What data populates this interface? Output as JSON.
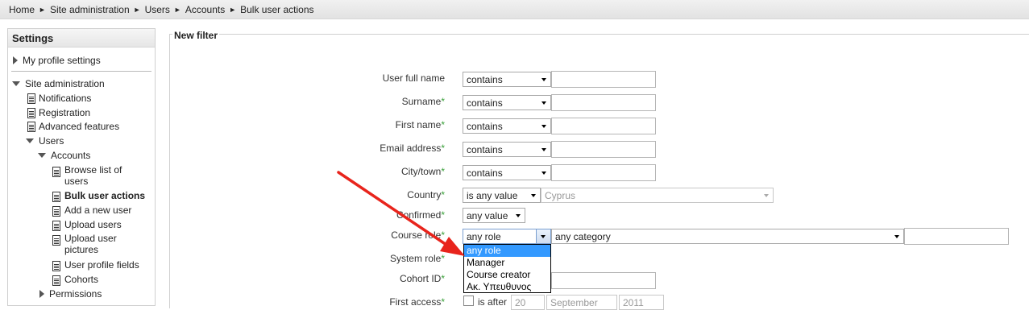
{
  "breadcrumb": [
    "Home",
    "Site administration",
    "Users",
    "Accounts",
    "Bulk user actions"
  ],
  "breadcrumb_separator": "►",
  "sidebar": {
    "title": "Settings",
    "my_profile": "My profile settings",
    "site_admin": "Site administration",
    "notifications": "Notifications",
    "registration": "Registration",
    "advanced_features": "Advanced features",
    "users": "Users",
    "accounts": "Accounts",
    "browse_line1": "Browse list of",
    "browse_line2": "users",
    "bulk_user_actions": "Bulk user actions",
    "add_new_user": "Add a new user",
    "upload_users": "Upload users",
    "upload_pictures_line1": "Upload user",
    "upload_pictures_line2": "pictures",
    "user_profile_fields": "User profile fields",
    "cohorts": "Cohorts",
    "permissions": "Permissions"
  },
  "filter": {
    "legend": "New filter",
    "required_mark": "*",
    "fields": {
      "fullname": {
        "label": "User full name",
        "op": "contains"
      },
      "surname": {
        "label": "Surname",
        "op": "contains"
      },
      "firstname": {
        "label": "First name",
        "op": "contains"
      },
      "email": {
        "label": "Email address",
        "op": "contains"
      },
      "city": {
        "label": "City/town",
        "op": "contains"
      },
      "country": {
        "label": "Country",
        "op": "is any value",
        "value": "Cyprus"
      },
      "confirmed": {
        "label": "Confirmed",
        "op": "any value"
      },
      "course_role": {
        "label": "Course role",
        "role": "any role",
        "category": "any category"
      },
      "system_role": {
        "label": "System role"
      },
      "cohort": {
        "label": "Cohort ID"
      },
      "first_access": {
        "label": "First access",
        "is_after": "is after",
        "day": "20",
        "month": "September",
        "year": "2011"
      }
    },
    "role_options": [
      "any role",
      "Manager",
      "Course creator",
      "Ακ. Υπευθυνος"
    ]
  },
  "colors": {
    "required": "#3aa13a",
    "highlight": "#3399ff",
    "arrow": "#e8241c"
  }
}
